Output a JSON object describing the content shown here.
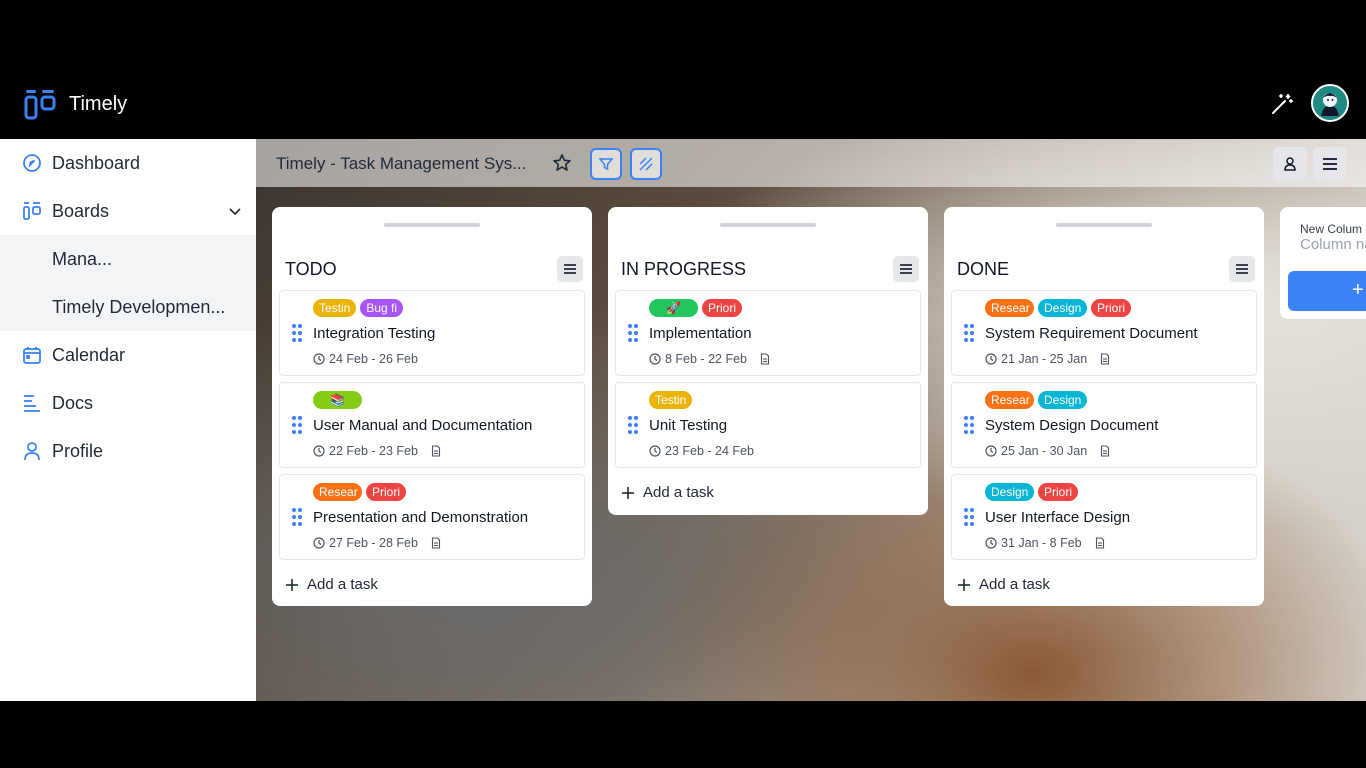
{
  "app": {
    "title": "Timely"
  },
  "sidebar": {
    "items": [
      {
        "label": "Dashboard"
      },
      {
        "label": "Boards"
      },
      {
        "label": "Calendar"
      },
      {
        "label": "Docs"
      },
      {
        "label": "Profile"
      }
    ],
    "boards": [
      {
        "label": "Mana..."
      },
      {
        "label": "Timely Developmen..."
      }
    ]
  },
  "board": {
    "title": "Timely - Task Management Sys..."
  },
  "columns": [
    {
      "title": "TODO",
      "add_label": "Add a task",
      "cards": [
        {
          "tags": [
            {
              "text": "Testin",
              "color": "#eab308"
            },
            {
              "text": "Bug fi",
              "color": "#a855f7"
            }
          ],
          "title": "Integration Testing",
          "date": "24 Feb - 26 Feb",
          "doc": false
        },
        {
          "tags": [
            {
              "text": "📚",
              "color": "#84cc16"
            }
          ],
          "title": "User Manual and Documentation",
          "date": "22 Feb - 23 Feb",
          "doc": true
        },
        {
          "tags": [
            {
              "text": "Resear",
              "color": "#f97316"
            },
            {
              "text": "Priori",
              "color": "#ef4444"
            }
          ],
          "title": "Presentation and Demonstration",
          "date": "27 Feb - 28 Feb",
          "doc": true
        }
      ]
    },
    {
      "title": "IN PROGRESS",
      "add_label": "Add a task",
      "cards": [
        {
          "tags": [
            {
              "text": "🚀",
              "color": "#22c55e"
            },
            {
              "text": "Priori",
              "color": "#ef4444"
            }
          ],
          "title": "Implementation",
          "date": "8 Feb - 22 Feb",
          "doc": true
        },
        {
          "tags": [
            {
              "text": "Testin",
              "color": "#eab308"
            }
          ],
          "title": "Unit Testing",
          "date": "23 Feb - 24 Feb",
          "doc": false
        }
      ]
    },
    {
      "title": "DONE",
      "add_label": "Add a task",
      "cards": [
        {
          "tags": [
            {
              "text": "Resear",
              "color": "#f97316"
            },
            {
              "text": "Design",
              "color": "#06b6d4"
            },
            {
              "text": "Priori",
              "color": "#ef4444"
            }
          ],
          "title": "System Requirement Document",
          "date": "21 Jan - 25 Jan",
          "doc": true
        },
        {
          "tags": [
            {
              "text": "Resear",
              "color": "#f97316"
            },
            {
              "text": "Design",
              "color": "#06b6d4"
            }
          ],
          "title": "System Design Document",
          "date": "25 Jan - 30 Jan",
          "doc": true
        },
        {
          "tags": [
            {
              "text": "Design",
              "color": "#06b6d4"
            },
            {
              "text": "Priori",
              "color": "#ef4444"
            }
          ],
          "title": "User Interface Design",
          "date": "31 Jan - 8 Feb",
          "doc": true
        }
      ]
    }
  ],
  "new_column": {
    "label": "New Colum",
    "placeholder": "Column na",
    "button": "+"
  },
  "colors": {
    "accent": "#3b82f6"
  }
}
